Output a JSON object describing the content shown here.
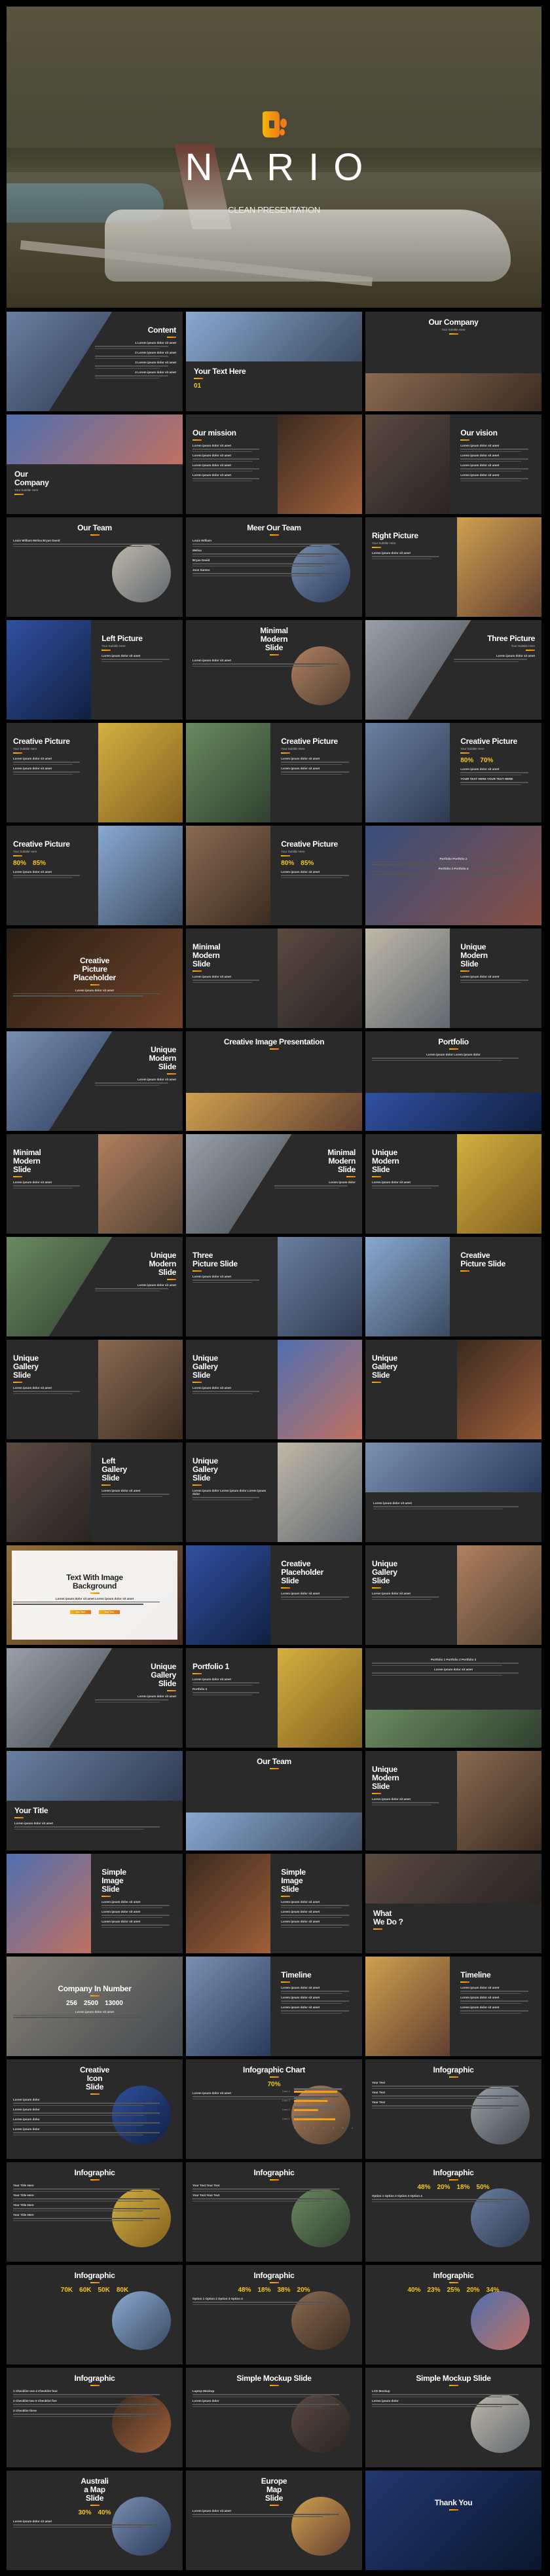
{
  "hero": {
    "title": "NARIO",
    "subtitle": "CLEAN PRESENTATION"
  },
  "accent": {
    "yellow": "#f5b800",
    "orange": "#e8731a",
    "slide_bg": "#2a2a2a",
    "page_bg": "#000000"
  },
  "slides": [
    {
      "title": "Content",
      "items": [
        "1  Lorem ipsum dolor sit amet",
        "2  Lorem ipsum dolor sit amet",
        "3  Lorem ipsum dolor sit amet",
        "4  Lorem ipsum dolor sit amet"
      ]
    },
    {
      "title": "Your Text Here",
      "stats": [
        "01"
      ]
    },
    {
      "title": "Our Company",
      "subtitle": "Your Subtitle Here"
    },
    {
      "title": "Our\nCompany",
      "subtitle": "Your Subtitle Here"
    },
    {
      "title": "Our mission",
      "items": [
        "Lorem ipsum dolor sit amet",
        "Lorem ipsum dolor sit amet",
        "Lorem ipsum dolor sit amet",
        "Lorem ipsum dolor sit amet"
      ]
    },
    {
      "title": "Our vision",
      "items": [
        "Lorem ipsum dolor sit amet",
        "Lorem ipsum dolor sit amet",
        "Lorem ipsum dolor sit amet",
        "Lorem ipsum dolor sit amet"
      ]
    },
    {
      "title": "Our Team",
      "items": [
        "Louis William  Melisa  Bryan David"
      ]
    },
    {
      "title": "Meer Our Team",
      "items": [
        "Louis William",
        "Melisa",
        "Bryan David",
        "Jose Santos"
      ]
    },
    {
      "title": "Right Picture",
      "subtitle": "Your Subtitle Here",
      "items": [
        "Lorem ipsum dolor sit amet"
      ]
    },
    {
      "title": "Left Picture",
      "subtitle": "Your Subtitle Here",
      "items": [
        "Lorem ipsum dolor sit amet"
      ]
    },
    {
      "title": "Minimal\nModern\nSlide",
      "items": [
        "Lorem ipsum dolor sit amet"
      ]
    },
    {
      "title": "Three Picture",
      "subtitle": "Your Subtitle Here",
      "items": [
        "Lorem ipsum dolor sit amet"
      ]
    },
    {
      "title": "Creative Picture",
      "subtitle": "Your Subtitle Here",
      "items": [
        "Lorem ipsum dolor sit amet",
        "Lorem ipsum dolor sit amet"
      ]
    },
    {
      "title": "Creative Picture",
      "subtitle": "Your Subtitle Here",
      "items": [
        "Lorem ipsum dolor sit amet",
        "Lorem ipsum dolor sit amet"
      ]
    },
    {
      "title": "Creative Picture",
      "subtitle": "Your Subtitle Here",
      "items": [
        "Lorem ipsum dolor sit amet",
        "YOUR TEXT HERE   YOUR TEXT HERE"
      ],
      "stats": [
        "80%",
        "70%"
      ]
    },
    {
      "title": "Creative Picture",
      "subtitle": "Your Subtitle Here",
      "items": [
        "Lorem ipsum dolor sit amet"
      ],
      "stats": [
        "80%",
        "85%"
      ]
    },
    {
      "title": "Creative Picture",
      "subtitle": "Your Subtitle Here",
      "items": [
        "Lorem ipsum dolor sit amet"
      ],
      "stats": [
        "80%",
        "85%"
      ]
    },
    {
      "title": "",
      "items": [
        "Portfolio   Portfolio 2",
        "Portfolio 3   Portfolio 4"
      ]
    },
    {
      "title": "Creative\nPicture\nPlaceholder",
      "items": [
        "Lorem ipsum dolor sit amet"
      ]
    },
    {
      "title": "Minimal\nModern\nSlide",
      "items": [
        "Lorem ipsum dolor sit amet"
      ]
    },
    {
      "title": "Unique\nModern\nSlide",
      "items": [
        "Lorem ipsum dolor sit amet"
      ]
    },
    {
      "title": "Unique\nModern\nSlide",
      "items": [
        "Lorem ipsum dolor sit amet"
      ]
    },
    {
      "title": "Creative Image Presentation"
    },
    {
      "title": "Portfolio",
      "items": [
        "Lorem ipsum dolor   Lorem ipsum dolor"
      ]
    },
    {
      "title": "Minimal\nModern\nSlide",
      "items": [
        "Lorem ipsum dolor sit amet"
      ]
    },
    {
      "title": "Minimal\nModern\nSlide",
      "items": [
        "Lorem ipsum dolor"
      ]
    },
    {
      "title": "Unique\nModern\nSlide",
      "items": [
        "Lorem ipsum dolor sit amet"
      ]
    },
    {
      "title": "Unique\nModern\nSlide",
      "items": [
        "Lorem ipsum dolor sit amet"
      ]
    },
    {
      "title": "Three\nPicture Slide",
      "items": [
        "Lorem ipsum dolor sit amet"
      ]
    },
    {
      "title": "Creative\nPicture Slide"
    },
    {
      "title": "Unique\nGallery\nSlide",
      "items": [
        "Lorem ipsum dolor sit amet"
      ]
    },
    {
      "title": "Unique\nGallery\nSlide",
      "items": [
        "Lorem ipsum dolor sit amet"
      ]
    },
    {
      "title": "Unique\nGallery\nSlide"
    },
    {
      "title": "Left\nGallery\nSlide",
      "items": [
        "Lorem ipsum dolor sit amet"
      ]
    },
    {
      "title": "Unique\nGallery\nSlide",
      "items": [
        "Lorem ipsum dolor   Lorem ipsum dolor   Lorem ipsum dolor"
      ]
    },
    {
      "title": "",
      "items": [
        "Lorem ipsum dolor sit amet"
      ]
    },
    {
      "title": "Text With Image\nBackground",
      "items": [
        "Lorem ipsum dolor sit amet   Lorem ipsum dolor sit amet"
      ],
      "buttons": [
        "Your Text",
        "Your Text"
      ]
    },
    {
      "title": "Creative\nPlaceholder\nSlide",
      "items": [
        "Lorem ipsum dolor sit amet"
      ]
    },
    {
      "title": "Unique\nGallery\nSlide",
      "items": [
        "Lorem ipsum dolor sit amet"
      ]
    },
    {
      "title": "Unique\nGallery\nSlide",
      "items": [
        "Lorem ipsum dolor sit amet"
      ]
    },
    {
      "title": "Portfolio 1",
      "items": [
        "Lorem ipsum dolor sit amet",
        "Portfolio 2"
      ]
    },
    {
      "title": "",
      "items": [
        "Portfolio 1   Portfolio 2   Portfolio 3",
        "Lorem ipsum dolor sit amet"
      ]
    },
    {
      "title": "Your Title",
      "items": [
        "Lorem ipsum dolor sit amet"
      ]
    },
    {
      "title": "Our Team"
    },
    {
      "title": "Unique\nModern\nSlide",
      "items": [
        "Lorem ipsum dolor sit amet"
      ]
    },
    {
      "title": "Simple\nImage\nSlide",
      "items": [
        "Lorem ipsum dolor sit amet",
        "Lorem ipsum dolor sit amet",
        "Lorem ipsum dolor sit amet"
      ]
    },
    {
      "title": "Simple\nImage\nSlide",
      "items": [
        "Lorem ipsum dolor sit amet",
        "Lorem ipsum dolor sit amet",
        "Lorem ipsum dolor sit amet"
      ]
    },
    {
      "title": "What\nWe Do ?"
    },
    {
      "title": "Company In Number",
      "stats": [
        "256",
        "2500",
        "13000"
      ],
      "items": [
        "Lorem ipsum dolor sit amet"
      ]
    },
    {
      "title": "Timeline",
      "items": [
        "Lorem ipsum dolor sit amet",
        "Lorem ipsum dolor sit amet",
        "Lorem ipsum dolor sit amet"
      ]
    },
    {
      "title": "Timeline",
      "items": [
        "Lorem ipsum dolor sit amet",
        "Lorem ipsum dolor sit amet",
        "Lorem ipsum dolor sit amet"
      ]
    },
    {
      "title": "Creative\nIcon\nSlide",
      "items": [
        "Lorem ipsum dolor",
        "Lorem ipsum dolor",
        "Lorem ipsum dolor",
        "Lorem ipsum dolor"
      ]
    },
    {
      "title": "Infographic Chart",
      "stats": [
        "70%"
      ],
      "items": [
        "Lorem ipsum dolor sit amet"
      ],
      "chart": {
        "categories": [
          "Data 4",
          "Data 3",
          "Data 2",
          "Data 1"
        ],
        "series_a": [
          5,
          3,
          4.5,
          2.5
        ],
        "series_b": [
          4.5,
          3.5,
          2.5,
          4.3
        ],
        "ticks": [
          "0",
          "1",
          "2",
          "3",
          "4",
          "5",
          "6"
        ]
      }
    },
    {
      "title": "Infographic",
      "items": [
        "Your Text",
        "Your Text",
        "Your Text"
      ]
    },
    {
      "title": "Infographic",
      "items": [
        "Your Title Here",
        "Your Title Here",
        "Your Title Here",
        "Your Title Here"
      ]
    },
    {
      "title": "Infographic",
      "items": [
        "Your Text   Your Text",
        "Your Text   Your Text"
      ]
    },
    {
      "title": "Infographic",
      "stats": [
        "48%",
        "20%",
        "18%",
        "50%"
      ],
      "items": [
        "Option 1  Option 2  Option 3  Option 4"
      ]
    },
    {
      "title": "Infographic",
      "stats": [
        "70K",
        "60K",
        "50K",
        "80K"
      ]
    },
    {
      "title": "Infographic",
      "stats": [
        "48%",
        "18%",
        "38%",
        "20%"
      ],
      "items": [
        "Option 1  Option 2  Option 3  Option 4"
      ]
    },
    {
      "title": "Infographic",
      "stats": [
        "40%",
        "23%",
        "25%",
        "20%",
        "34%"
      ]
    },
    {
      "title": "Infographic",
      "items": [
        "1 Checklist one   4 Checklist four",
        "2 Checklist two   5 Checklist five",
        "3 Checklist three"
      ]
    },
    {
      "title": "Simple Mockup Slide",
      "items": [
        "Laptop Mockup",
        "Lorem ipsum dolor"
      ]
    },
    {
      "title": "Simple Mockup Slide",
      "items": [
        "LCD Mockup",
        "Lorem ipsum dolor"
      ]
    },
    {
      "title": "Australi\na Map\nSlide",
      "stats": [
        "30%",
        "40%"
      ],
      "items": [
        "Lorem ipsum dolor sit amet"
      ]
    },
    {
      "title": "Europe\nMap\nSlide",
      "items": [
        "Lorem ipsum dolor sit amet"
      ]
    },
    {
      "title": "Thank You"
    }
  ]
}
